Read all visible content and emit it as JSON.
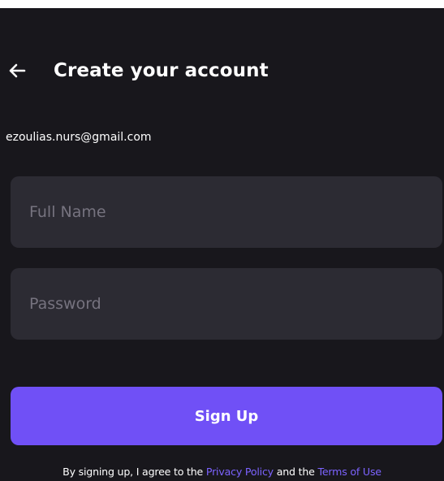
{
  "header": {
    "back_icon": "arrow-left-icon",
    "title": "Create your account"
  },
  "account": {
    "email": "ezoulias.nurs@gmail.com"
  },
  "form": {
    "full_name": {
      "value": "",
      "placeholder": "Full Name"
    },
    "password": {
      "value": "",
      "placeholder": "Password"
    },
    "submit_label": "Sign Up"
  },
  "terms": {
    "prefix": "By signing up, I agree to the ",
    "privacy_link": "Privacy Policy",
    "middle": " and the ",
    "terms_link": "Terms of Use"
  },
  "colors": {
    "background": "#18171c",
    "field_background": "#2c2b33",
    "accent": "#7050f6",
    "link": "#7c63ff",
    "placeholder": "#76737f"
  }
}
